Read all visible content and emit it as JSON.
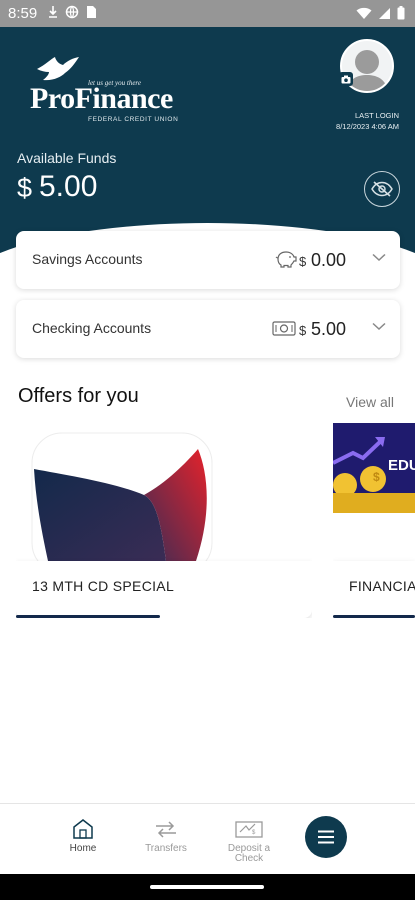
{
  "status_bar": {
    "time": "8:59",
    "left_icons": [
      "download-icon",
      "globe-icon",
      "sim-card-icon"
    ],
    "right_icons": [
      "wifi-icon",
      "signal-icon",
      "battery-icon"
    ]
  },
  "header": {
    "logo": {
      "name": "ProFinance",
      "tagline": "let us get you there",
      "subtitle": "FEDERAL CREDIT UNION"
    },
    "last_login_label": "LAST LOGIN",
    "last_login_value": "8/12/2023 4:06 AM",
    "funds_label": "Available Funds",
    "funds_currency": "$",
    "funds_amount": "5.00"
  },
  "accounts": [
    {
      "label": "Savings Accounts",
      "icon": "piggy-bank-icon",
      "currency": "$",
      "amount": "0.00"
    },
    {
      "label": "Checking Accounts",
      "icon": "cash-icon",
      "currency": "$",
      "amount": "5.00"
    }
  ],
  "offers": {
    "title": "Offers for you",
    "view_all": "View all",
    "items": [
      {
        "label": "13 MTH CD SPECIAL",
        "progress": 0.5
      },
      {
        "label": "FINANCIA",
        "image_text": "EDU"
      }
    ]
  },
  "bottom_nav": {
    "items": [
      {
        "label": "Home",
        "icon": "home-icon",
        "active": true
      },
      {
        "label": "Transfers",
        "icon": "transfer-icon",
        "active": false
      },
      {
        "label": "Deposit a Check",
        "icon": "check-deposit-icon",
        "active": false
      }
    ],
    "menu_icon": "menu-icon"
  },
  "colors": {
    "header_bg": "#0e3a4e",
    "accent_navy": "#13294b",
    "offer_red": "#e5222b"
  }
}
